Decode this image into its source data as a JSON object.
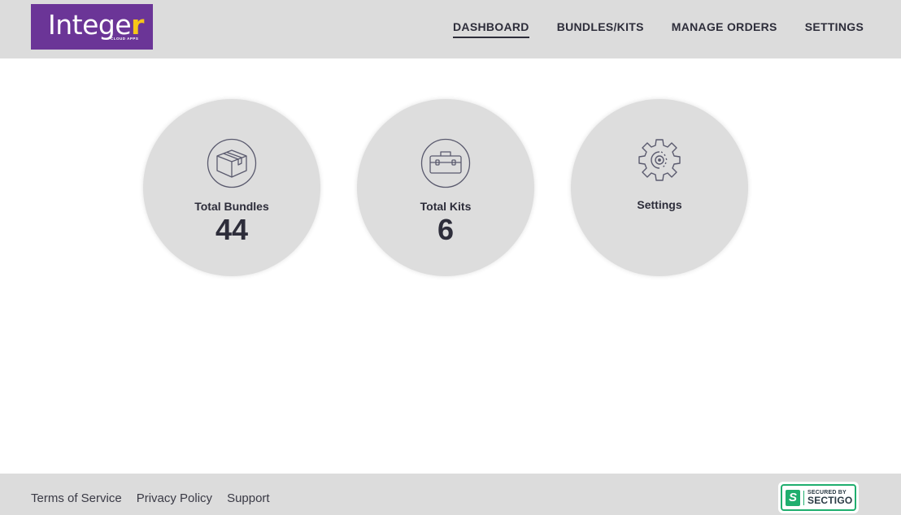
{
  "header": {
    "logo": {
      "text_main": "Intege",
      "text_accent": "r",
      "subtitle": "CLOUD APPS",
      "brand_color": "#6b3597",
      "accent_color": "#f5c518"
    },
    "nav": [
      {
        "label": "DASHBOARD",
        "active": true
      },
      {
        "label": "BUNDLES/KITS",
        "active": false
      },
      {
        "label": "MANAGE ORDERS",
        "active": false
      },
      {
        "label": "SETTINGS",
        "active": false
      }
    ]
  },
  "cards": [
    {
      "icon": "box-icon",
      "label": "Total Bundles",
      "value": "44"
    },
    {
      "icon": "toolbox-icon",
      "label": "Total Kits",
      "value": "6"
    },
    {
      "icon": "gear-icon",
      "label": "Settings",
      "value": null
    }
  ],
  "footer": {
    "links": [
      {
        "label": "Terms of Service"
      },
      {
        "label": "Privacy Policy"
      },
      {
        "label": "Support"
      }
    ],
    "badge": {
      "icon": "S",
      "line1": "SECURED BY",
      "line2": "SECTIGO",
      "color": "#1fae6e"
    }
  }
}
